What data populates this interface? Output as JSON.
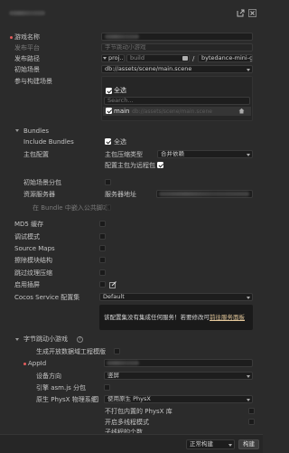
{
  "header": {
    "platform_label": "",
    "icons": [
      "external-link-icon",
      "close-icon"
    ]
  },
  "form": {
    "game_name": {
      "label": "游戏名称"
    },
    "publish_platform": {
      "label": "发布平台",
      "value": "字节跳动小游戏"
    },
    "publish_path": {
      "label": "发布路径",
      "project_label": "proj...",
      "build_value": "build",
      "slash": "/",
      "dir_value": "bytedance-mini-g"
    },
    "start_scene": {
      "label": "初始场景",
      "value": "db://assets/scene/main.scene"
    },
    "build_scenes": {
      "label": "参与构建场景",
      "select_all": "全选",
      "search_placeholder": "Search...",
      "scene_name": "main",
      "scene_path": "db://assets/scene/main.scene"
    }
  },
  "bundles": {
    "title": "Bundles",
    "include_label": "Include Bundles",
    "include_select_all": "全选",
    "main_config_label": "主包配置",
    "compress_type_label": "主包压缩类型",
    "compress_type_value": "合并依赖",
    "as_remote_label": "配置主包为远程包",
    "initial_scene_sub_label": "初始场景分包",
    "resource_server_label": "资源服务器",
    "server_address_label": "服务器地址",
    "embed_script_label": "在 Bundle 中嵌入公共脚本"
  },
  "options": {
    "md5": "MD5 缓存",
    "debug": "调试模式",
    "source_maps": "Source Maps",
    "replace_splash": "擦除模块结构",
    "skip_texture": "跳过纹理压缩",
    "splash": "启用插屏",
    "cocos_service": "Cocos Service 配置集",
    "cocos_service_value": "Default",
    "service_notice": "该配置集没有集成任何服务！若要修改可前往服务面板",
    "service_notice_prefix": "该配置集没有集成任何服务！若要修改可",
    "service_notice_link": "前往服务面板"
  },
  "bytedance": {
    "title": "字节跳动小游戏",
    "gen_template_label": "生成开放数据域工程模版",
    "appid_label": "AppId",
    "orientation_label": "设备方向",
    "orientation_value": "竖屏",
    "asmjs_label": "引擎 asm.js 分包",
    "physx_label": "原生 PhysX 物理系统",
    "physx_value": "使用原生 PhysX",
    "physx_no_pkg_label": "不打包内置的 PhysX 库",
    "multi_thread_label": "开启多线程模式",
    "sub_thread_label": "子线程的个数"
  },
  "footer": {
    "build_mode": "正常构建",
    "build_button": "构建"
  }
}
